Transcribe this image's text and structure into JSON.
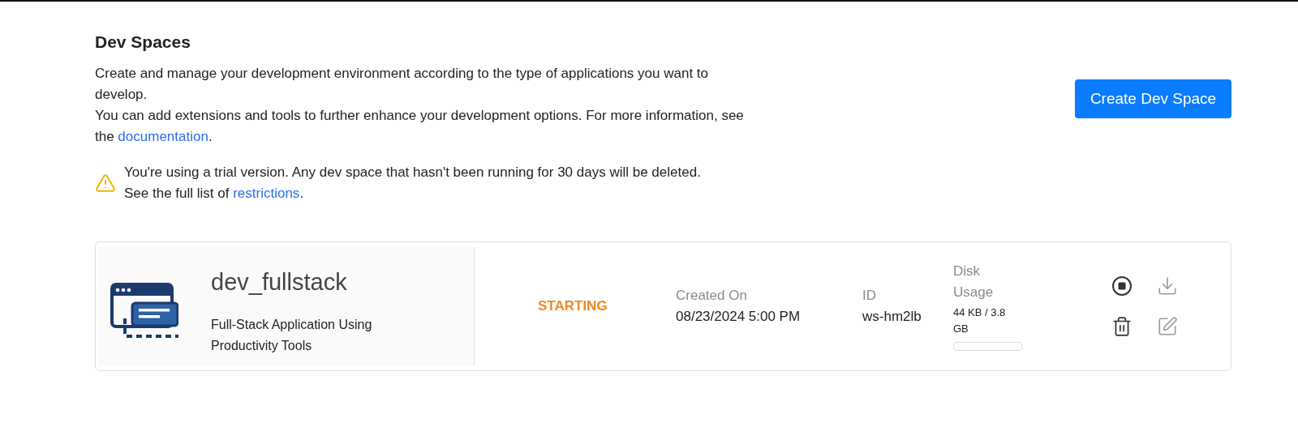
{
  "page": {
    "title": "Dev Spaces",
    "description": [
      "Create and manage your development environment according to the type of applications you want to develop.",
      {
        "before": "You can add extensions and tools to further enhance your development options. For more information, see the ",
        "link": "documentation",
        "after": "."
      }
    ],
    "create_button": "Create Dev Space",
    "warning": {
      "line1": "You're using a trial version. Any dev space that hasn't been running for 30 days will be deleted.",
      "before": "See the full list of ",
      "link": "restrictions",
      "after": "."
    }
  },
  "dev_spaces": [
    {
      "name": "dev_fullstack",
      "type": "Full-Stack Application Using Productivity Tools",
      "status": "STARTING",
      "created_label": "Created On",
      "created": "08/23/2024 5:00 PM",
      "id_label": "ID",
      "id": "ws-hm2lb",
      "disk_label": "Disk Usage",
      "disk": "44 KB / 3.8 GB",
      "level": 0,
      "actions": [
        {
          "kind": "stop",
          "disabled": false
        },
        {
          "kind": "download",
          "disabled": true
        },
        {
          "kind": "delete",
          "disabled": false
        },
        {
          "kind": "edit",
          "disabled": true
        }
      ]
    }
  ]
}
